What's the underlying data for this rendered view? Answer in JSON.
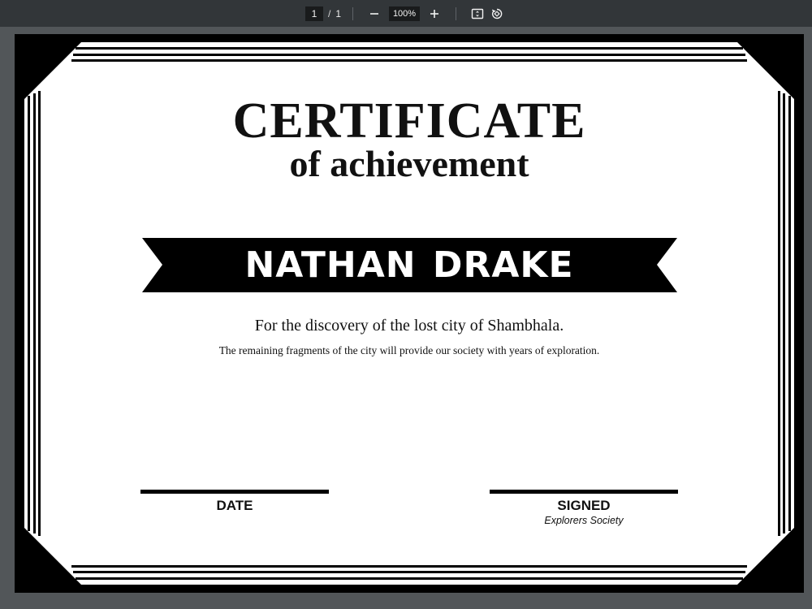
{
  "toolbar": {
    "current_page": "1",
    "page_separator": "/",
    "total_pages": "1",
    "zoom_level": "100%",
    "zoom_out_icon": "minus-icon",
    "zoom_in_icon": "plus-icon",
    "fit_icon": "fit-to-page-icon",
    "rotate_icon": "rotate-icon"
  },
  "certificate": {
    "title": "CERTIFICATE",
    "subtitle": "of achievement",
    "recipient": "NATHAN DRAKE",
    "reason": "For the discovery of the lost city of Shambhala.",
    "reason_detail": "The remaining fragments of the city will provide our society with years of exploration.",
    "date_label": "DATE",
    "signed_label": "SIGNED",
    "signed_by": "Explorers Society"
  },
  "colors": {
    "viewer_background": "#525659",
    "toolbar_background": "#323639",
    "ink": "#000000",
    "paper": "#ffffff"
  }
}
